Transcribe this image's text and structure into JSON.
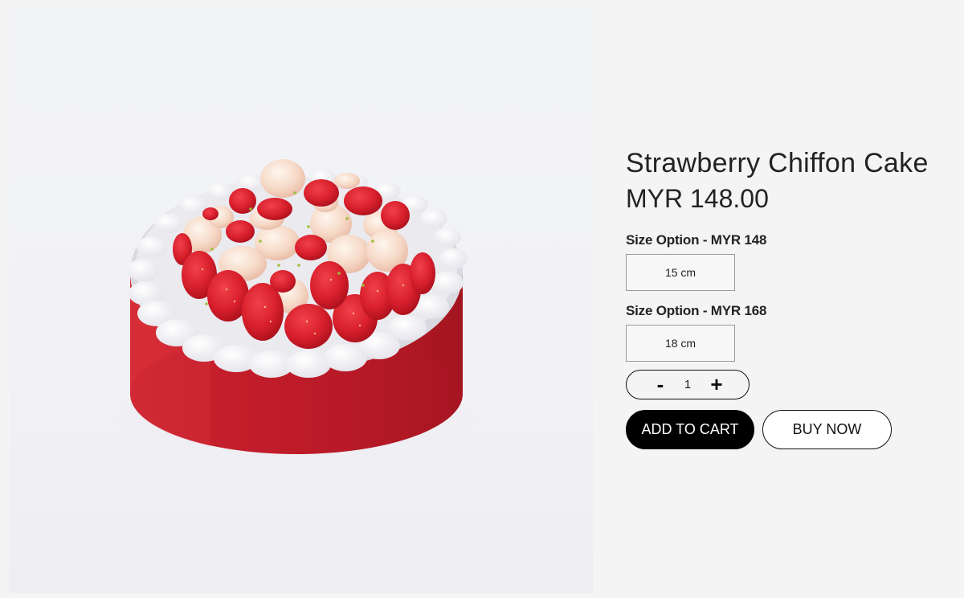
{
  "product": {
    "title": "Strawberry Chiffon Cake",
    "price": "MYR 148.00",
    "image_alt": "Strawberry chiffon cake with red glaze, whipped cream rosettes and red and white strawberries"
  },
  "options": [
    {
      "label": "Size Option - MYR 148",
      "value": "15 cm"
    },
    {
      "label": "Size Option - MYR 168",
      "value": "18 cm"
    }
  ],
  "quantity": {
    "minus_label": "-",
    "value": "1",
    "plus_label": "+"
  },
  "actions": {
    "add_to_cart": "ADD TO CART",
    "buy_now": "BUY NOW"
  },
  "colors": {
    "background": "#f4f4f4",
    "primary_button": "#000000",
    "cake_red": "#c8212c"
  }
}
